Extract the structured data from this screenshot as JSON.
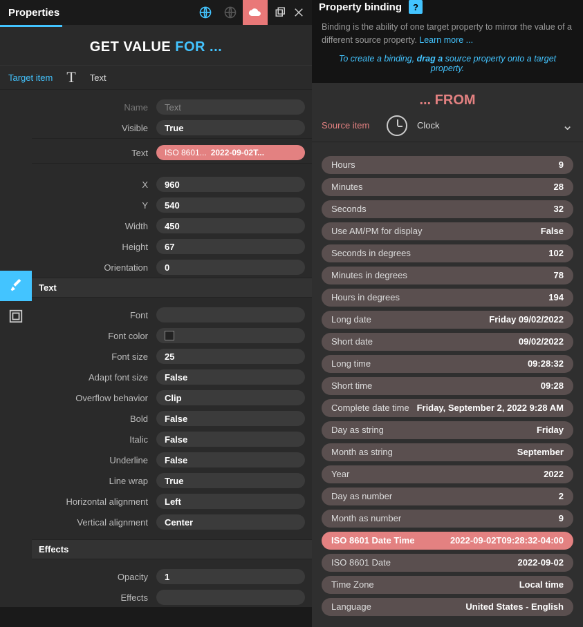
{
  "left": {
    "panel_title": "Properties",
    "big_title_1": "GET VALUE ",
    "big_title_2": "FOR ...",
    "target_label": "Target item",
    "target_name": "Text",
    "groups": {
      "name": {
        "label": "Name",
        "value": "Text"
      },
      "visible": {
        "label": "Visible",
        "value": "True"
      },
      "text": {
        "label": "Text",
        "bound_prefix": "ISO 8601...",
        "bound_value": "2022-09-02T..."
      },
      "x": {
        "label": "X",
        "value": "960"
      },
      "y": {
        "label": "Y",
        "value": "540"
      },
      "width": {
        "label": "Width",
        "value": "450"
      },
      "height": {
        "label": "Height",
        "value": "67"
      },
      "orientation": {
        "label": "Orientation",
        "value": "0"
      }
    },
    "text_section_title": "Text",
    "text_props": {
      "font": {
        "label": "Font",
        "value": ""
      },
      "font_color": {
        "label": "Font color"
      },
      "font_size": {
        "label": "Font size",
        "value": "25"
      },
      "adapt": {
        "label": "Adapt font size",
        "value": "False"
      },
      "overflow": {
        "label": "Overflow behavior",
        "value": "Clip"
      },
      "bold": {
        "label": "Bold",
        "value": "False"
      },
      "italic": {
        "label": "Italic",
        "value": "False"
      },
      "underline": {
        "label": "Underline",
        "value": "False"
      },
      "linewrap": {
        "label": "Line wrap",
        "value": "True"
      },
      "halign": {
        "label": "Horizontal alignment",
        "value": "Left"
      },
      "valign": {
        "label": "Vertical alignment",
        "value": "Center"
      }
    },
    "effects_section_title": "Effects",
    "effects": {
      "opacity": {
        "label": "Opacity",
        "value": "1"
      },
      "effects": {
        "label": "Effects",
        "value": ""
      }
    }
  },
  "right": {
    "panel_title": "Property binding",
    "help": "?",
    "desc_1": "Binding is the ability of one target property to mirror the value of a different source property. ",
    "learn_more": "Learn more ...",
    "hint_1": "To create a binding, ",
    "hint_b": "drag  a",
    "hint_2": "  source property onto a target property.",
    "from_title": "... FROM",
    "source_label": "Source item",
    "source_name": "Clock",
    "items": [
      {
        "name": "Hours",
        "value": "9"
      },
      {
        "name": "Minutes",
        "value": "28"
      },
      {
        "name": "Seconds",
        "value": "32"
      },
      {
        "name": "Use AM/PM for display",
        "value": "False"
      },
      {
        "name": "Seconds in degrees",
        "value": "102"
      },
      {
        "name": "Minutes in degrees",
        "value": "78"
      },
      {
        "name": "Hours in degrees",
        "value": "194"
      },
      {
        "name": "Long date",
        "value": "Friday 09/02/2022"
      },
      {
        "name": "Short date",
        "value": "09/02/2022"
      },
      {
        "name": "Long time",
        "value": "09:28:32"
      },
      {
        "name": "Short time",
        "value": "09:28"
      },
      {
        "name": "Complete date time",
        "value": "Friday, September 2, 2022 9:28 AM"
      },
      {
        "name": "Day as string",
        "value": "Friday"
      },
      {
        "name": "Month as string",
        "value": "September"
      },
      {
        "name": "Year",
        "value": "2022"
      },
      {
        "name": "Day as number",
        "value": "2"
      },
      {
        "name": "Month as number",
        "value": "9"
      },
      {
        "name": "ISO 8601 Date Time",
        "value": "2022-09-02T09:28:32-04:00",
        "selected": true
      },
      {
        "name": "ISO 8601 Date",
        "value": "2022-09-02"
      },
      {
        "name": "Time Zone",
        "value": "Local time"
      },
      {
        "name": "Language",
        "value": "United States - English"
      }
    ]
  }
}
